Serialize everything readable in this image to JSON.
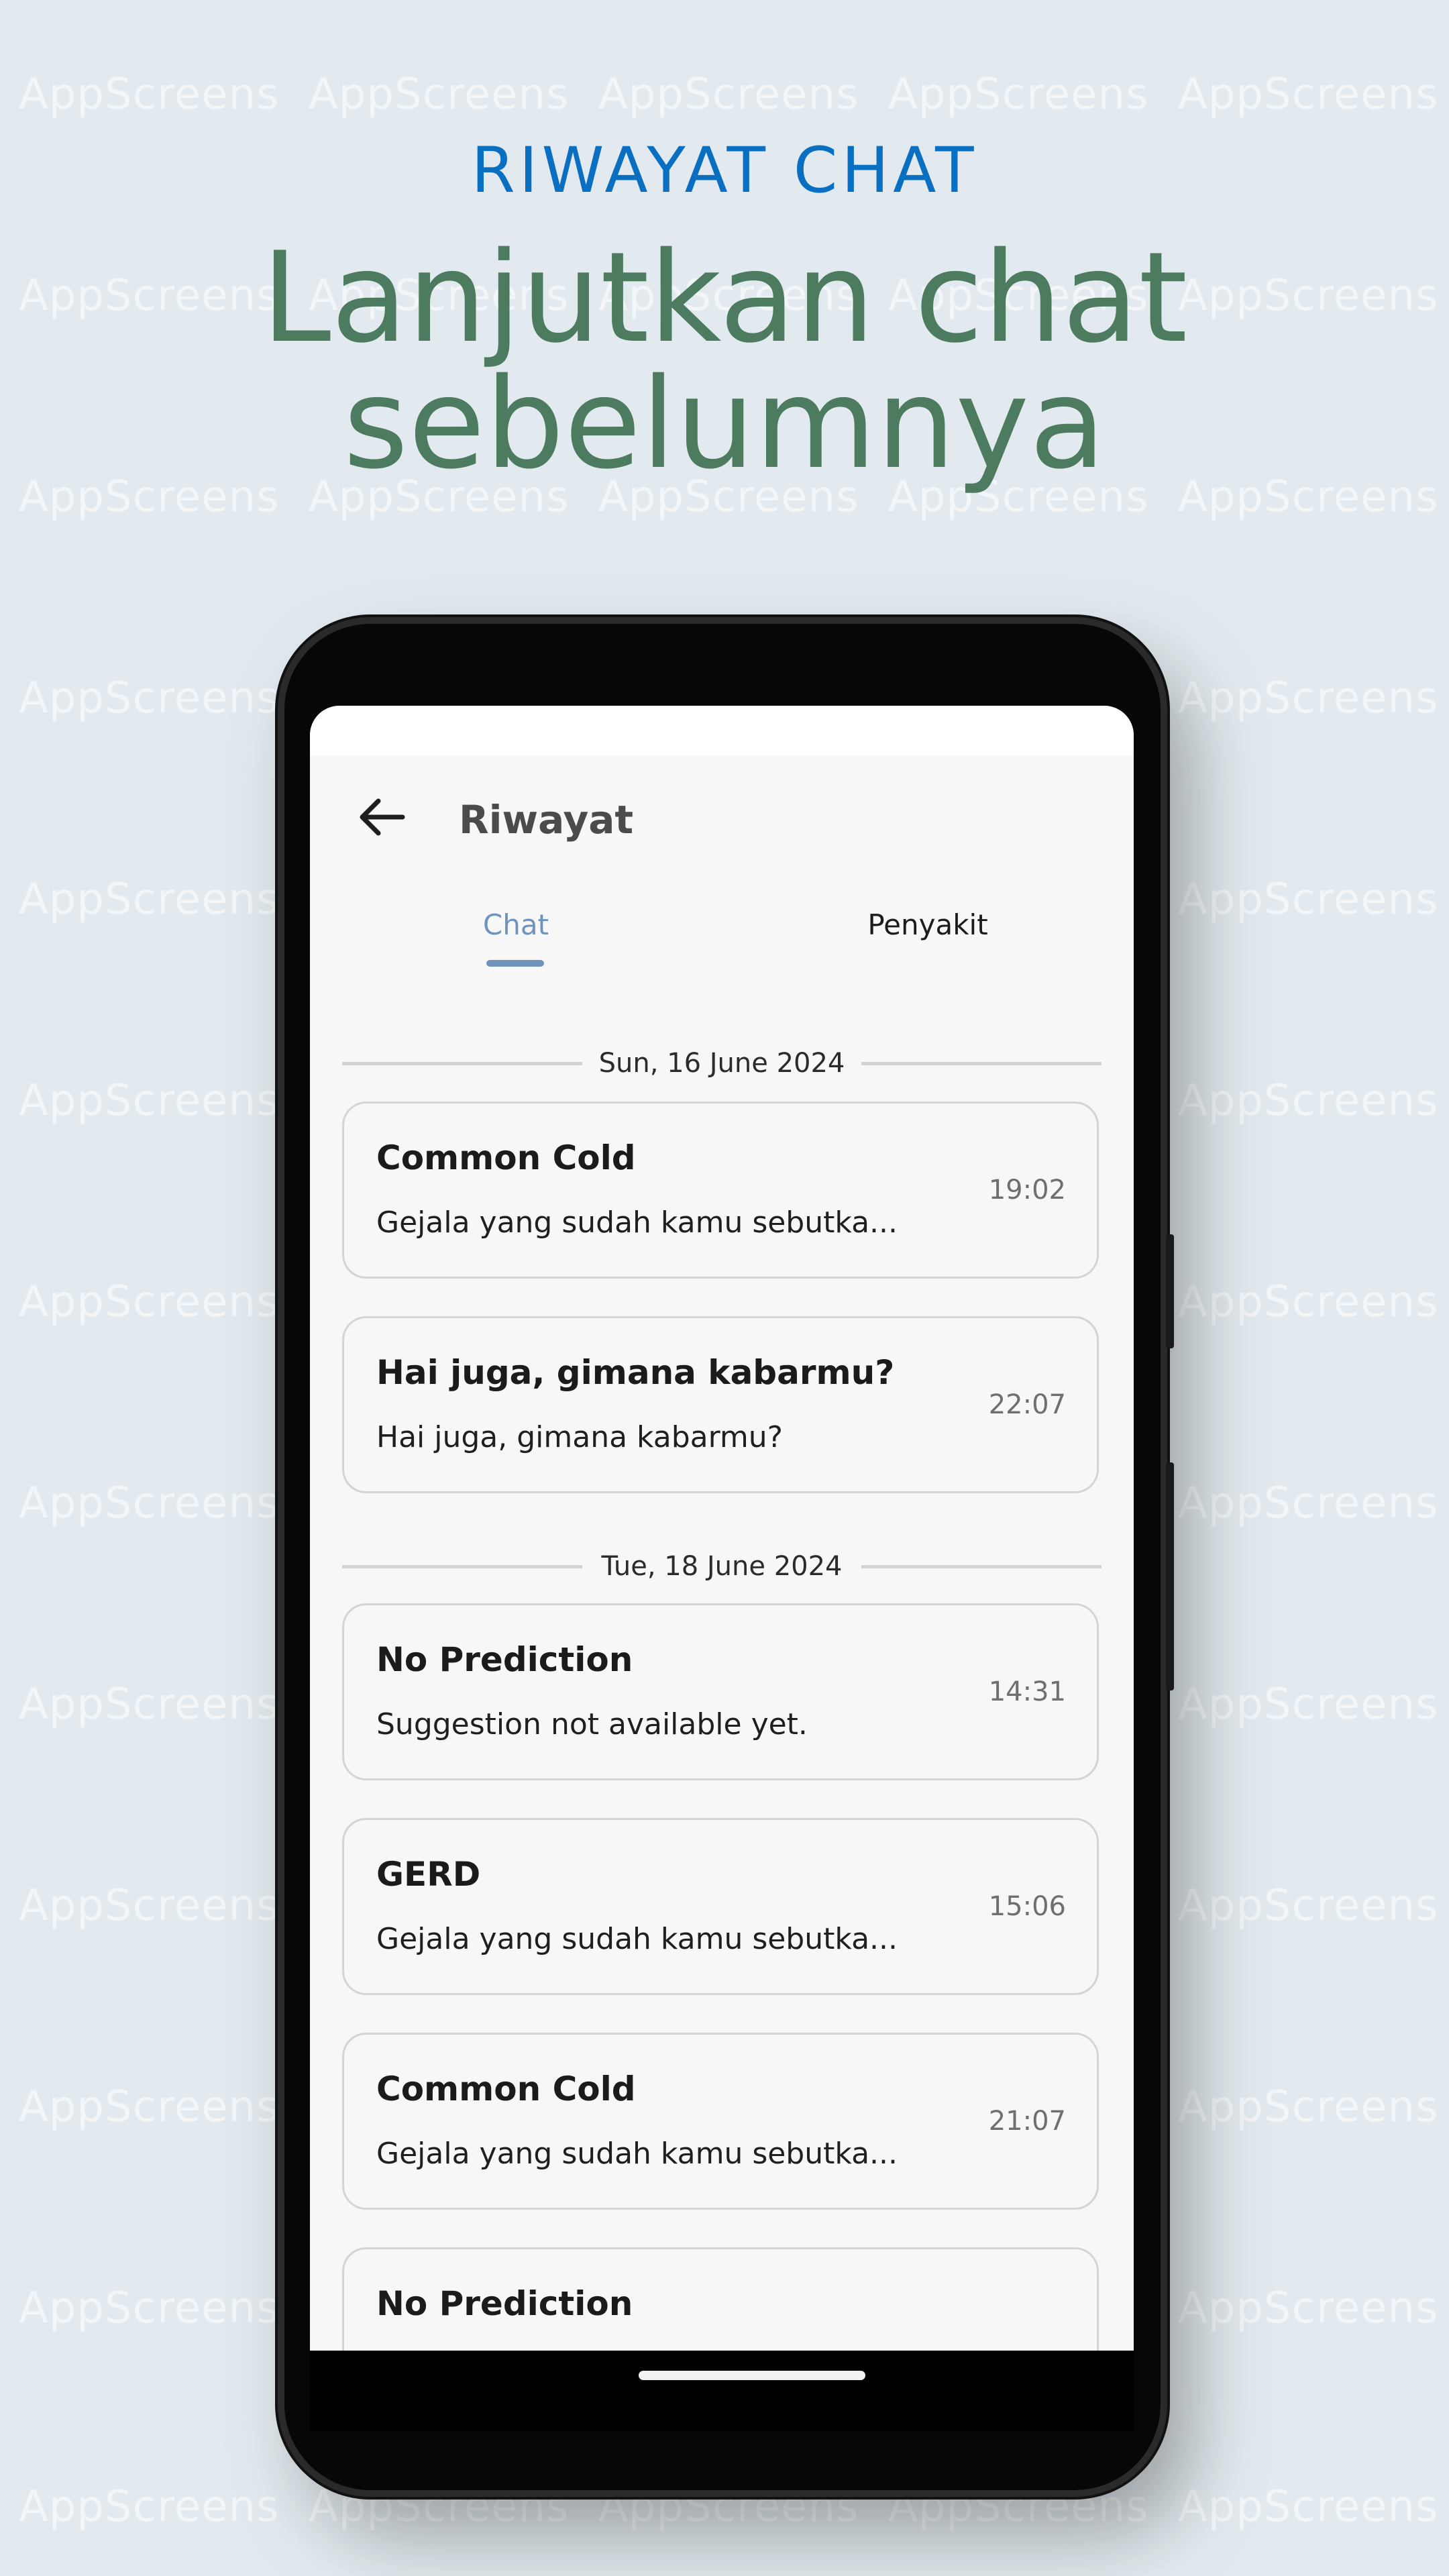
{
  "watermark": "AppScreens",
  "headline": {
    "eyebrow": "RIWAYAT CHAT",
    "title_line1": "Lanjutkan chat",
    "title_line2": "sebelumnya"
  },
  "app": {
    "title": "Riwayat",
    "tabs": [
      {
        "label": "Chat",
        "selected": true
      },
      {
        "label": "Penyakit",
        "selected": false
      }
    ],
    "groups": [
      {
        "date": "Sun, 16 June 2024",
        "items": [
          {
            "title": "Common Cold",
            "snippet": "Gejala yang sudah kamu sebutka...",
            "time": "19:02"
          },
          {
            "title": "Hai juga, gimana kabarmu?",
            "snippet": "Hai juga, gimana kabarmu?",
            "time": "22:07"
          }
        ]
      },
      {
        "date": "Tue, 18 June 2024",
        "items": [
          {
            "title": "No Prediction",
            "snippet": "Suggestion not available yet.",
            "time": "14:31"
          },
          {
            "title": "GERD",
            "snippet": "Gejala yang sudah kamu sebutka...",
            "time": "15:06"
          },
          {
            "title": "Common Cold",
            "snippet": "Gejala yang sudah kamu sebutka...",
            "time": "21:07"
          },
          {
            "title": "No Prediction",
            "snippet": "",
            "time": ""
          }
        ]
      }
    ]
  },
  "colors": {
    "background": "#e2eaef",
    "eyebrow": "#0a6fc1",
    "title": "#4d7b5f",
    "tab_active": "#6f93ba"
  },
  "icons": {
    "back": "arrow-left-icon"
  }
}
